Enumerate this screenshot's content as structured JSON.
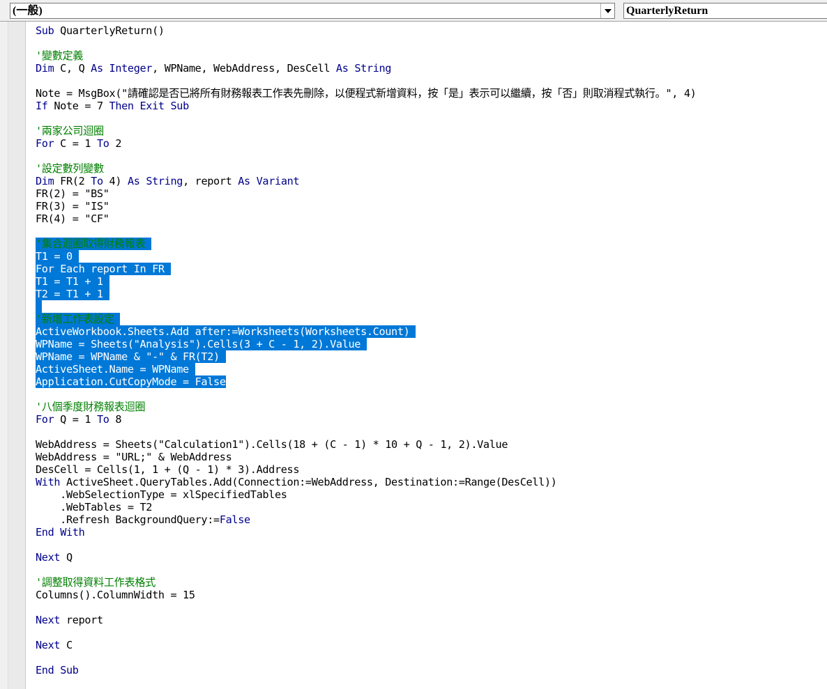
{
  "toolbar": {
    "object_combo": "(一般)",
    "procedure_combo": "QuarterlyReturn"
  },
  "colors": {
    "keyword": "#00008b",
    "comment": "#008000",
    "selection": "#0078d7"
  },
  "code": {
    "lines": [
      {
        "text": "Sub QuarterlyReturn()",
        "type": "code"
      },
      {
        "text": "",
        "type": "blank"
      },
      {
        "text": "'變數定義",
        "type": "comment"
      },
      {
        "text": "Dim C, Q As Integer, WPName, WebAddress, DesCell As String",
        "type": "code"
      },
      {
        "text": "",
        "type": "blank"
      },
      {
        "text": "Note = MsgBox(\"請確認是否已將所有財務報表工作表先刪除，以便程式新增資料，按「是」表示可以繼續，按「否」則取消程式執行。\", 4)",
        "type": "code"
      },
      {
        "text": "If Note = 7 Then Exit Sub",
        "type": "code"
      },
      {
        "text": "",
        "type": "blank"
      },
      {
        "text": "'兩家公司迴圈",
        "type": "comment"
      },
      {
        "text": "For C = 1 To 2",
        "type": "code"
      },
      {
        "text": "",
        "type": "blank"
      },
      {
        "text": "'設定數列變數",
        "type": "comment"
      },
      {
        "text": "Dim FR(2 To 4) As String, report As Variant",
        "type": "code"
      },
      {
        "text": "FR(2) = \"BS\"",
        "type": "code"
      },
      {
        "text": "FR(3) = \"IS\"",
        "type": "code"
      },
      {
        "text": "FR(4) = \"CF\"",
        "type": "code"
      },
      {
        "text": "",
        "type": "blank"
      },
      {
        "text": "'集合迴圈取得財務報表 ",
        "type": "comment",
        "selected": true
      },
      {
        "text": "T1 = 0 ",
        "type": "code",
        "selected": true
      },
      {
        "text": "For Each report In FR ",
        "type": "code",
        "selected": true
      },
      {
        "text": "T1 = T1 + 1 ",
        "type": "code",
        "selected": true
      },
      {
        "text": "T2 = T1 + 1 ",
        "type": "code",
        "selected": true
      },
      {
        "text": " ",
        "type": "blank",
        "selected": true
      },
      {
        "text": "'新增工作表設定 ",
        "type": "comment",
        "selected": true
      },
      {
        "text": "ActiveWorkbook.Sheets.Add after:=Worksheets(Worksheets.Count) ",
        "type": "code",
        "selected": true
      },
      {
        "text": "WPName = Sheets(\"Analysis\").Cells(3 + C - 1, 2).Value ",
        "type": "code",
        "selected": true
      },
      {
        "text": "WPName = WPName & \"-\" & FR(T2) ",
        "type": "code",
        "selected": true
      },
      {
        "text": "ActiveSheet.Name = WPName ",
        "type": "code",
        "selected": true
      },
      {
        "text": "Application.CutCopyMode = False",
        "type": "code",
        "selected": true
      },
      {
        "text": "",
        "type": "blank"
      },
      {
        "text": "'八個季度財務報表迴圈",
        "type": "comment"
      },
      {
        "text": "For Q = 1 To 8",
        "type": "code"
      },
      {
        "text": "",
        "type": "blank"
      },
      {
        "text": "WebAddress = Sheets(\"Calculation1\").Cells(18 + (C - 1) * 10 + Q - 1, 2).Value",
        "type": "code"
      },
      {
        "text": "WebAddress = \"URL;\" & WebAddress",
        "type": "code"
      },
      {
        "text": "DesCell = Cells(1, 1 + (Q - 1) * 3).Address",
        "type": "code"
      },
      {
        "text": "With ActiveSheet.QueryTables.Add(Connection:=WebAddress, Destination:=Range(DesCell))",
        "type": "code"
      },
      {
        "text": "    .WebSelectionType = xlSpecifiedTables",
        "type": "code"
      },
      {
        "text": "    .WebTables = T2",
        "type": "code"
      },
      {
        "text": "    .Refresh BackgroundQuery:=False",
        "type": "code"
      },
      {
        "text": "End With",
        "type": "code"
      },
      {
        "text": "",
        "type": "blank"
      },
      {
        "text": "Next Q",
        "type": "code"
      },
      {
        "text": "",
        "type": "blank"
      },
      {
        "text": "'調整取得資料工作表格式",
        "type": "comment"
      },
      {
        "text": "Columns().ColumnWidth = 15",
        "type": "code"
      },
      {
        "text": "",
        "type": "blank"
      },
      {
        "text": "Next report",
        "type": "code"
      },
      {
        "text": "",
        "type": "blank"
      },
      {
        "text": "Next C",
        "type": "code"
      },
      {
        "text": "",
        "type": "blank"
      },
      {
        "text": "End Sub",
        "type": "code"
      }
    ]
  }
}
